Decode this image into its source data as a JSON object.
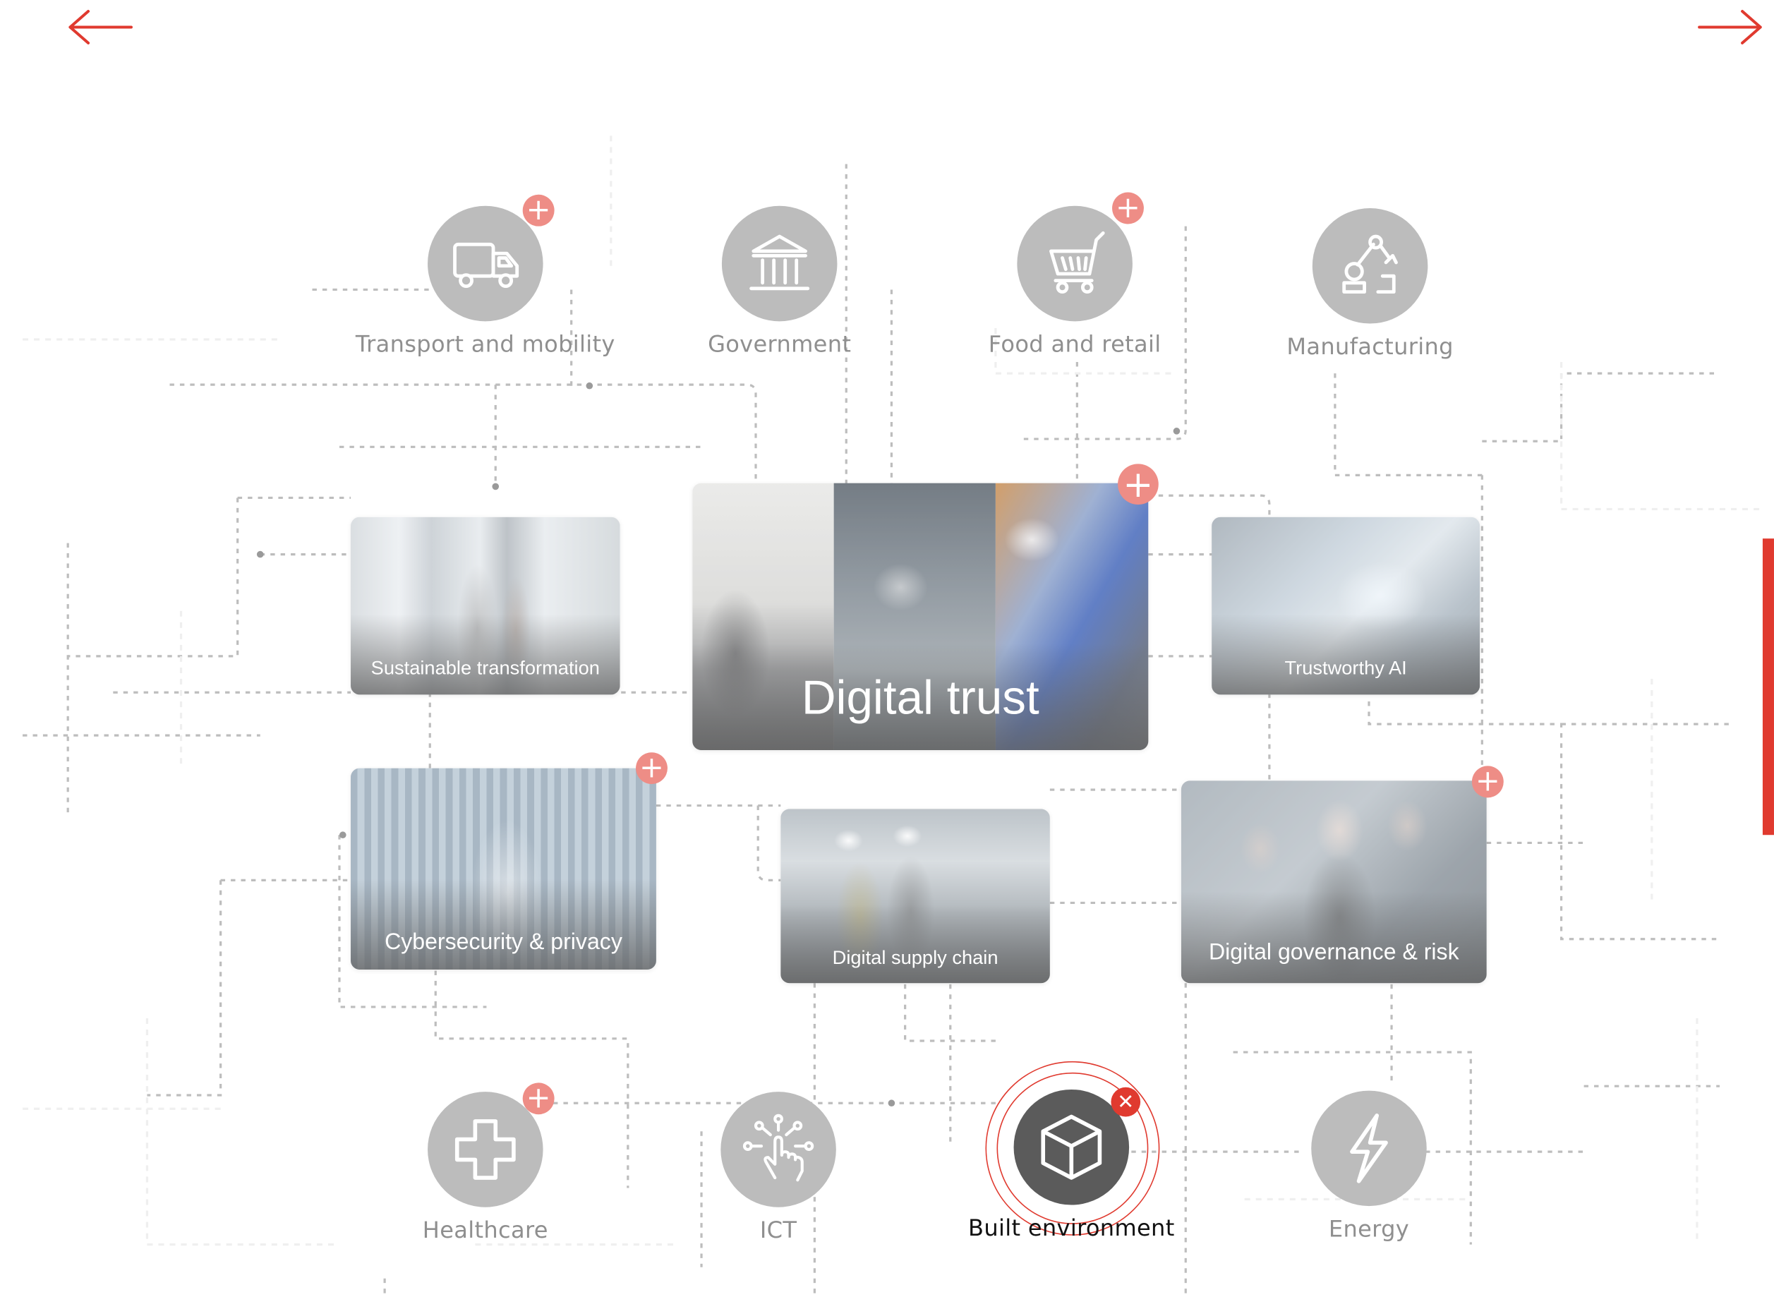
{
  "colors": {
    "accent": "#e03a2f",
    "badge": "#ee8d86",
    "circle_inactive": "#bcbcbc",
    "circle_active": "#5b5b5b",
    "label_inactive": "#8f8f8f"
  },
  "nav": {
    "prev_icon": "arrow-left-icon",
    "next_icon": "arrow-right-icon"
  },
  "sectors_top": [
    {
      "label": "Transport and mobility",
      "icon": "truck-icon",
      "has_plus": true
    },
    {
      "label": "Government",
      "icon": "government-building-icon",
      "has_plus": false
    },
    {
      "label": "Food and retail",
      "icon": "shopping-cart-icon",
      "has_plus": true
    },
    {
      "label": "Manufacturing",
      "icon": "robot-arm-icon",
      "has_plus": false
    }
  ],
  "sectors_bottom": [
    {
      "label": "Healthcare",
      "icon": "medical-cross-icon",
      "has_plus": true
    },
    {
      "label": "ICT",
      "icon": "touch-circuit-icon",
      "has_plus": false
    },
    {
      "label": "Built environment",
      "icon": "cube-icon",
      "active": true,
      "close_symbol": "✕"
    },
    {
      "label": "Energy",
      "icon": "lightning-icon",
      "has_plus": false
    }
  ],
  "topics": {
    "main": {
      "label": "Digital trust",
      "has_plus": true
    },
    "sustainable": {
      "label": "Sustainable transformation"
    },
    "trustworthy_ai": {
      "label": "Trustworthy AI"
    },
    "cybersecurity": {
      "label": "Cybersecurity & privacy",
      "has_plus": true
    },
    "supply_chain": {
      "label": "Digital supply chain"
    },
    "governance": {
      "label": "Digital governance & risk",
      "has_plus": true
    }
  },
  "plus_symbol": "+"
}
